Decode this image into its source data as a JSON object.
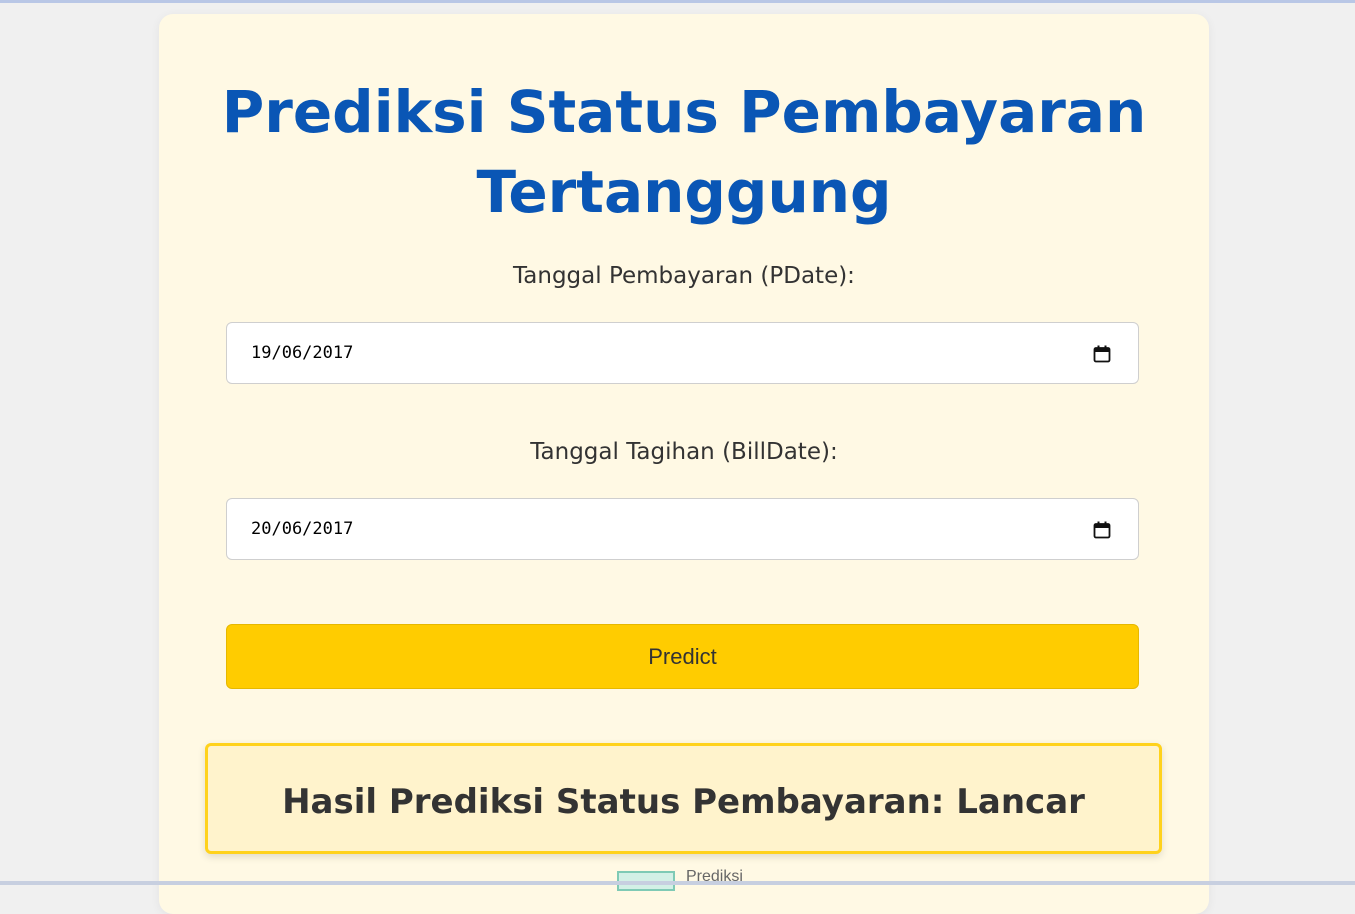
{
  "page": {
    "title": "Prediksi Status Pembayaran Tertanggung"
  },
  "form": {
    "pdate_label": "Tanggal Pembayaran (PDate):",
    "pdate_value": "19/06/2017",
    "billdate_label": "Tanggal Tagihan (BillDate):",
    "billdate_value": "20/06/2017",
    "predict_label": "Predict"
  },
  "result": {
    "text": "Hasil Prediksi Status Pembayaran: Lancar"
  },
  "legend": {
    "label": "Prediksi"
  },
  "icons": {
    "date_picker": "calendar-icon"
  },
  "colors": {
    "title": "#0a56b5",
    "button": "#ffcc00",
    "result_border": "#ffd21c",
    "card": "#fff9e4"
  }
}
